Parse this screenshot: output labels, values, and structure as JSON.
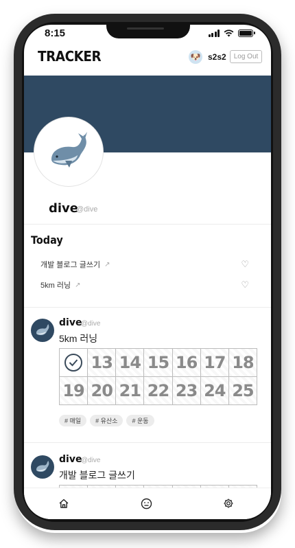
{
  "status": {
    "time": "8:15"
  },
  "header": {
    "logo": "TRACKER",
    "avatar_emoji": "🐶",
    "username": "s2s2",
    "logout_label": "Log Out"
  },
  "profile": {
    "name": "dive",
    "handle": "@dive",
    "avatar_emoji": "🐋"
  },
  "today": {
    "title": "Today",
    "items": [
      {
        "label": "개발 블로그 글쓰기",
        "arrow": "↗",
        "heart": "♡"
      },
      {
        "label": "5km 러닝",
        "arrow": "↗",
        "heart": "♡"
      }
    ]
  },
  "posts": [
    {
      "name": "dive",
      "handle": "@dive",
      "title": "5km 러닝",
      "days": [
        "",
        "13",
        "14",
        "15",
        "16",
        "17",
        "18",
        "19",
        "20",
        "21",
        "22",
        "23",
        "24",
        "25"
      ],
      "tags": [
        "# 매일",
        "# 유산소",
        "# 운동"
      ]
    },
    {
      "name": "dive",
      "handle": "@dive",
      "title": "개발 블로그 글쓰기"
    }
  ],
  "tabs": [
    "home-icon",
    "smile-icon",
    "gear-icon"
  ],
  "colors": {
    "banner": "#2f4962",
    "accent": "#3a4a5a"
  }
}
